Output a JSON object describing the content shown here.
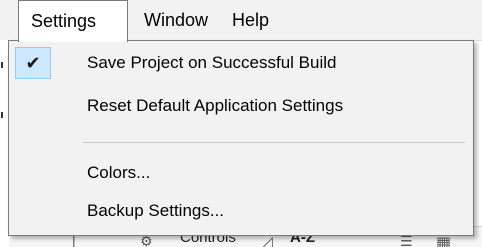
{
  "menubar": {
    "items": [
      {
        "label": "Settings"
      },
      {
        "label": "Window"
      },
      {
        "label": "Help"
      }
    ]
  },
  "dropdown": {
    "items": [
      {
        "label": "Save Project on Successful Build",
        "checked": true,
        "icon": "check-icon"
      },
      {
        "label": "Reset Default Application Settings",
        "checked": false
      },
      {
        "label": "Colors...",
        "checked": false
      },
      {
        "label": "Backup Settings...",
        "checked": false
      }
    ]
  },
  "background_toolbar": {
    "controls_label": "Controls",
    "az_label": "A-Z"
  },
  "colors": {
    "menu_bg": "#f2f2f2",
    "check_highlight": "#cde8ff",
    "check_border": "#99c9f0",
    "border": "#7a7a7a"
  }
}
